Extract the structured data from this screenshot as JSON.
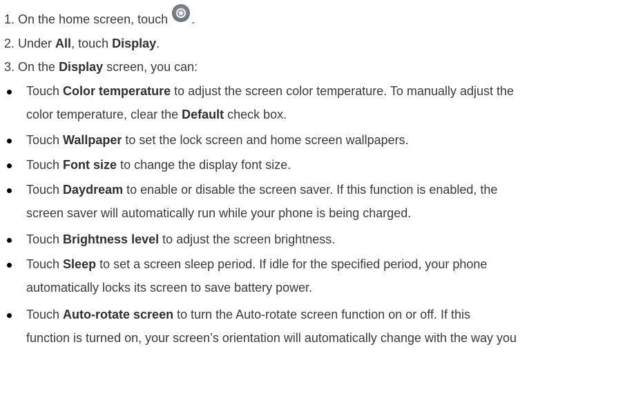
{
  "steps": [
    {
      "num": "1.",
      "pre": " On the home screen, touch",
      "post": "."
    },
    {
      "num": "2.",
      "pre": " Under ",
      "b1": "All",
      "mid": ", touch ",
      "b2": "Display",
      "post": "."
    },
    {
      "num": "3.",
      "pre": " On the ",
      "b1": "Display",
      "post": " screen, you can:"
    }
  ],
  "settings_icon": "settings-gear-icon",
  "bullets": [
    {
      "pre": "Touch ",
      "term": "Color temperature",
      "line1": " to adjust the screen color temperature. To manually adjust the",
      "line2_pre": "color temperature, clear the ",
      "line2_term": "Default",
      "line2_post": " check box."
    },
    {
      "pre": "Touch ",
      "term": "Wallpaper",
      "line1": " to set the lock screen and home screen wallpapers."
    },
    {
      "pre": "Touch ",
      "term": "Font size",
      "line1": " to change the display font size."
    },
    {
      "pre": "Touch ",
      "term": "Daydream",
      "line1": " to enable or disable the screen saver. If this function is enabled, the",
      "line2": "screen saver will automatically run while your phone is being charged."
    },
    {
      "pre": "Touch ",
      "term": "Brightness level",
      "line1": " to adjust the screen brightness."
    },
    {
      "pre": "Touch ",
      "term": "Sleep",
      "line1": " to set a screen sleep period. If idle for the specified period, your phone",
      "line2": "automatically locks its screen to save battery power."
    },
    {
      "pre": "Touch ",
      "term": "Auto-rotate screen",
      "line1": " to turn the Auto-rotate screen function on or off. If this",
      "line2": "function is turned on, your screen’s orientation will automatically change with the way you"
    }
  ]
}
